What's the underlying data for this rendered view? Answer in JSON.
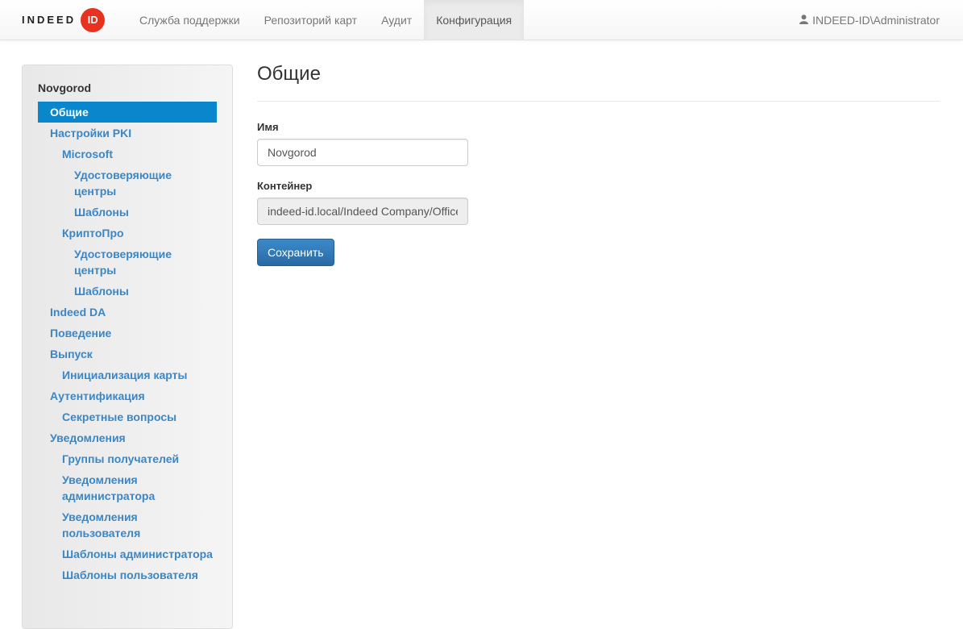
{
  "brand": {
    "text": "INDEED",
    "badge": "ID",
    "color": "#e8321f"
  },
  "nav": {
    "tabs": [
      {
        "label": "Служба поддержки"
      },
      {
        "label": "Репозиторий карт"
      },
      {
        "label": "Аудит"
      },
      {
        "label": "Конфигурация",
        "active": true
      }
    ],
    "user": "INDEED-ID\\Administrator",
    "user_icon": "user-icon"
  },
  "sidebar": {
    "title": "Novgorod",
    "items": [
      {
        "label": "Общие",
        "level": 0,
        "active": true
      },
      {
        "label": "Настройки PKI",
        "level": 0
      },
      {
        "label": "Microsoft",
        "level": 1
      },
      {
        "label": "Удостоверяющие центры",
        "level": 2
      },
      {
        "label": "Шаблоны",
        "level": 2
      },
      {
        "label": "КриптоПро",
        "level": 1
      },
      {
        "label": "Удостоверяющие центры",
        "level": 2
      },
      {
        "label": "Шаблоны",
        "level": 2
      },
      {
        "label": "Indeed DA",
        "level": 0
      },
      {
        "label": "Поведение",
        "level": 0
      },
      {
        "label": "Выпуск",
        "level": 0
      },
      {
        "label": "Инициализация карты",
        "level": 1
      },
      {
        "label": "Аутентификация",
        "level": 0
      },
      {
        "label": "Секретные вопросы",
        "level": 1
      },
      {
        "label": "Уведомления",
        "level": 0
      },
      {
        "label": "Группы получателей",
        "level": 1
      },
      {
        "label": "Уведомления администратора",
        "level": 1
      },
      {
        "label": "Уведомления пользователя",
        "level": 1
      },
      {
        "label": "Шаблоны администратора",
        "level": 1
      },
      {
        "label": "Шаблоны пользователя",
        "level": 1
      }
    ],
    "accent": "#0a87cc"
  },
  "main": {
    "title": "Общие",
    "name_label": "Имя",
    "name_value": "Novgorod",
    "container_label": "Контейнер",
    "container_value": "indeed-id.local/Indeed Company/Office",
    "save_label": "Сохранить"
  }
}
